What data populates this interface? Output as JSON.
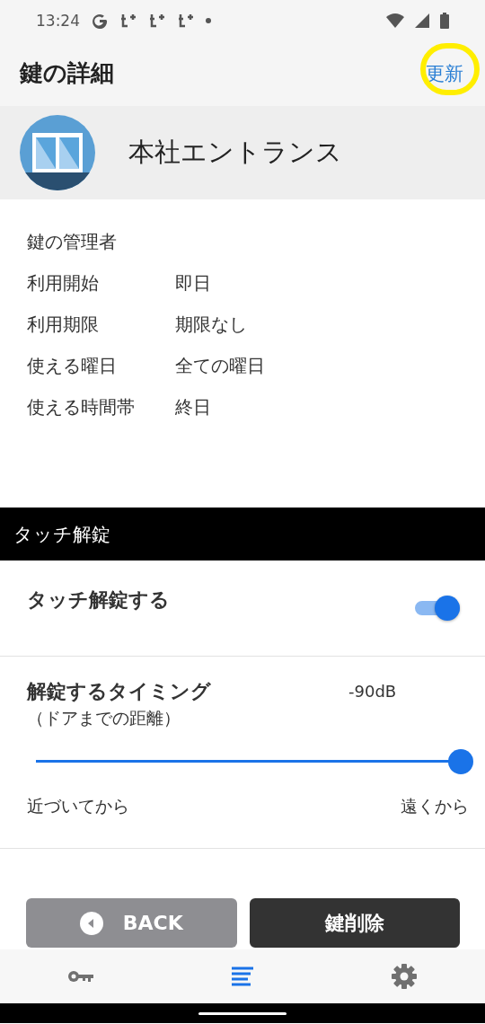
{
  "status_bar": {
    "time": "13:24"
  },
  "header": {
    "title": "鍵の詳細",
    "action": {
      "label": "更新",
      "highlighted": true
    }
  },
  "key": {
    "name": "本社エントランス"
  },
  "details": [
    {
      "label": "鍵の管理者"
    },
    {
      "label": "利用開始",
      "value": "即日"
    },
    {
      "label": "利用期限",
      "value": "期限なし"
    },
    {
      "label": "使える曜日",
      "value": "全ての曜日"
    },
    {
      "label": "使える時間帯",
      "value": "終日"
    }
  ],
  "section": {
    "title": "タッチ解錠"
  },
  "touch_unlock": {
    "label": "タッチ解錠する",
    "on": true
  },
  "timing": {
    "label": "解錠するタイミング",
    "sublabel": "（ドアまでの距離）",
    "reading": "-90dB",
    "level": 1.0,
    "min_label": "近づいてから",
    "max_label": "遠くから"
  },
  "buttons": [
    {
      "label": "BACK",
      "kind": "back"
    },
    {
      "label": "鍵削除",
      "kind": "danger"
    }
  ],
  "nav": [
    {
      "kind": "key",
      "selected": false
    },
    {
      "kind": "list",
      "selected": true
    },
    {
      "kind": "settings",
      "selected": false
    }
  ]
}
